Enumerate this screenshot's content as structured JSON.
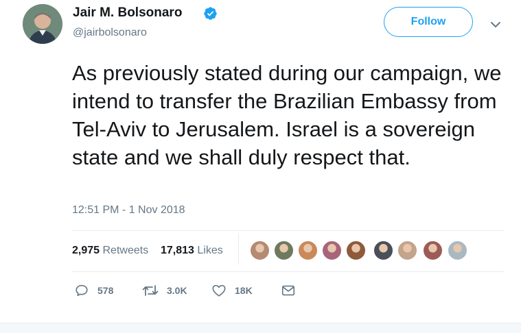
{
  "author": {
    "name": "Jair M. Bolsonaro",
    "handle": "@jairbolsonaro",
    "verified": true
  },
  "follow_button": {
    "label": "Follow"
  },
  "tweet": {
    "text": "As previously stated during our campaign, we intend to transfer the Brazilian Embassy from Tel-Aviv to Jerusalem. Israel is a sovereign state and we shall duly respect that.",
    "timestamp": "12:51 PM - 1 Nov 2018"
  },
  "stats": {
    "retweets_count": "2,975",
    "retweets_label": "Retweets",
    "likes_count": "17,813",
    "likes_label": "Likes"
  },
  "liker_avatars": [
    "#b58a73",
    "#6d7a5e",
    "#c9895a",
    "#a8657a",
    "#8e5a3c",
    "#4a4f58",
    "#c2a58a",
    "#9c5c55",
    "#aab8c2"
  ],
  "actions": {
    "reply_count": "578",
    "retweet_count": "3.0K",
    "like_count": "18K"
  },
  "colors": {
    "accent": "#1da1f2",
    "text": "#14171a",
    "secondary": "#657786",
    "border": "#e6ecf0"
  }
}
